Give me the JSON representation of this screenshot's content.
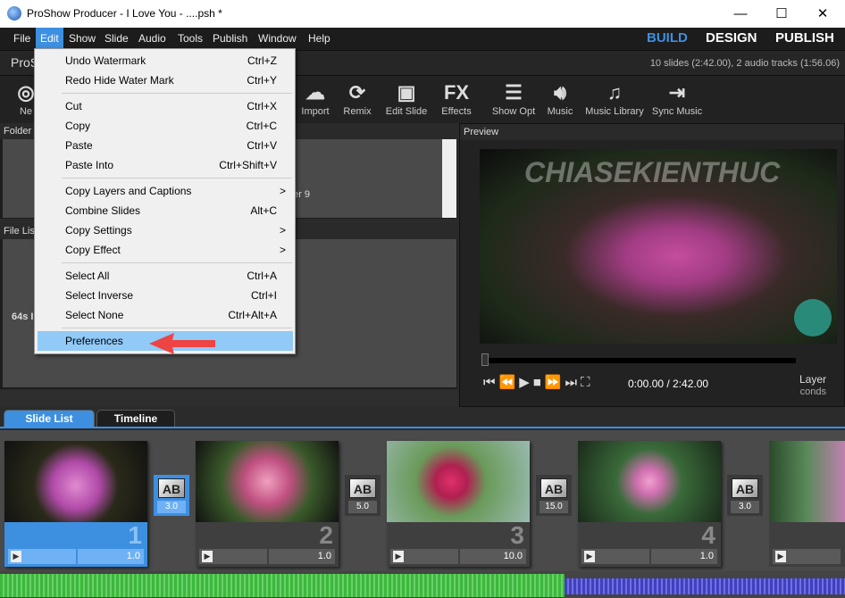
{
  "window": {
    "title": "ProShow Producer - I Love You - ....psh *",
    "minimize": "—",
    "maximize": "☐",
    "close": "✕"
  },
  "menubar": {
    "items": [
      "File",
      "Edit",
      "Show",
      "Slide",
      "Audio",
      "Tools",
      "Publish",
      "Window",
      "Help"
    ],
    "modes": [
      "BUILD",
      "DESIGN",
      "PUBLISH"
    ],
    "active_mode_color": "#3d8fe0"
  },
  "subheader": {
    "app_label": "ProS",
    "info": "10 slides (2:42.00), 2 audio tracks (1:56.06)"
  },
  "toolbar": {
    "items": [
      {
        "label": "Ne",
        "icon": "new-icon"
      },
      {
        "label": "Import",
        "icon": "cloud-import-icon"
      },
      {
        "label": "Remix",
        "icon": "remix-wand-icon"
      },
      {
        "label": "Edit Slide",
        "icon": "edit-slide-icon"
      },
      {
        "label": "Effects",
        "icon": "fx-icon"
      },
      {
        "label": "Show Opt",
        "icon": "show-options-icon"
      },
      {
        "label": "Music",
        "icon": "speaker-icon"
      },
      {
        "label": "Music Library",
        "icon": "music-library-icon"
      },
      {
        "label": "Sync Music",
        "icon": "sync-music-icon"
      }
    ]
  },
  "folder": {
    "title": "Folder",
    "partial_text": "er 9"
  },
  "file_list": {
    "title": "File Lis",
    "partial_text": "64s I"
  },
  "preview": {
    "title": "Preview",
    "time": "0:00.00 / 2:42.00",
    "layer_label": "Layer",
    "seconds_label": "conds",
    "watermark": "CHIASEKIENTHUC"
  },
  "edit_menu": {
    "items": [
      {
        "label": "Undo Watermark",
        "shortcut": "Ctrl+Z"
      },
      {
        "label": "Redo Hide Water Mark",
        "shortcut": "Ctrl+Y"
      },
      {
        "label": "Cut",
        "shortcut": "Ctrl+X"
      },
      {
        "label": "Copy",
        "shortcut": "Ctrl+C"
      },
      {
        "label": "Paste",
        "shortcut": "Ctrl+V"
      },
      {
        "label": "Paste Into",
        "shortcut": "Ctrl+Shift+V"
      },
      {
        "label": "Copy Layers and Captions",
        "shortcut": ">"
      },
      {
        "label": "Combine Slides",
        "shortcut": "Alt+C"
      },
      {
        "label": "Copy Settings",
        "shortcut": ">"
      },
      {
        "label": "Copy Effect",
        "shortcut": ">"
      },
      {
        "label": "Select All",
        "shortcut": "Ctrl+A"
      },
      {
        "label": "Select Inverse",
        "shortcut": "Ctrl+I"
      },
      {
        "label": "Select None",
        "shortcut": "Ctrl+Alt+A"
      },
      {
        "label": "Preferences",
        "shortcut": ""
      }
    ],
    "highlighted": "Preferences"
  },
  "tabs": [
    "Slide List",
    "Timeline"
  ],
  "slides": [
    {
      "number": "1",
      "duration": "1.0",
      "transition": "3.0"
    },
    {
      "number": "2",
      "duration": "1.0",
      "transition": "5.0"
    },
    {
      "number": "3",
      "duration": "10.0",
      "transition": "15.0"
    },
    {
      "number": "4",
      "duration": "1.0",
      "transition": "3.0"
    },
    {
      "number": "",
      "duration": "",
      "transition": ""
    }
  ],
  "transition_icon_text": "AB"
}
